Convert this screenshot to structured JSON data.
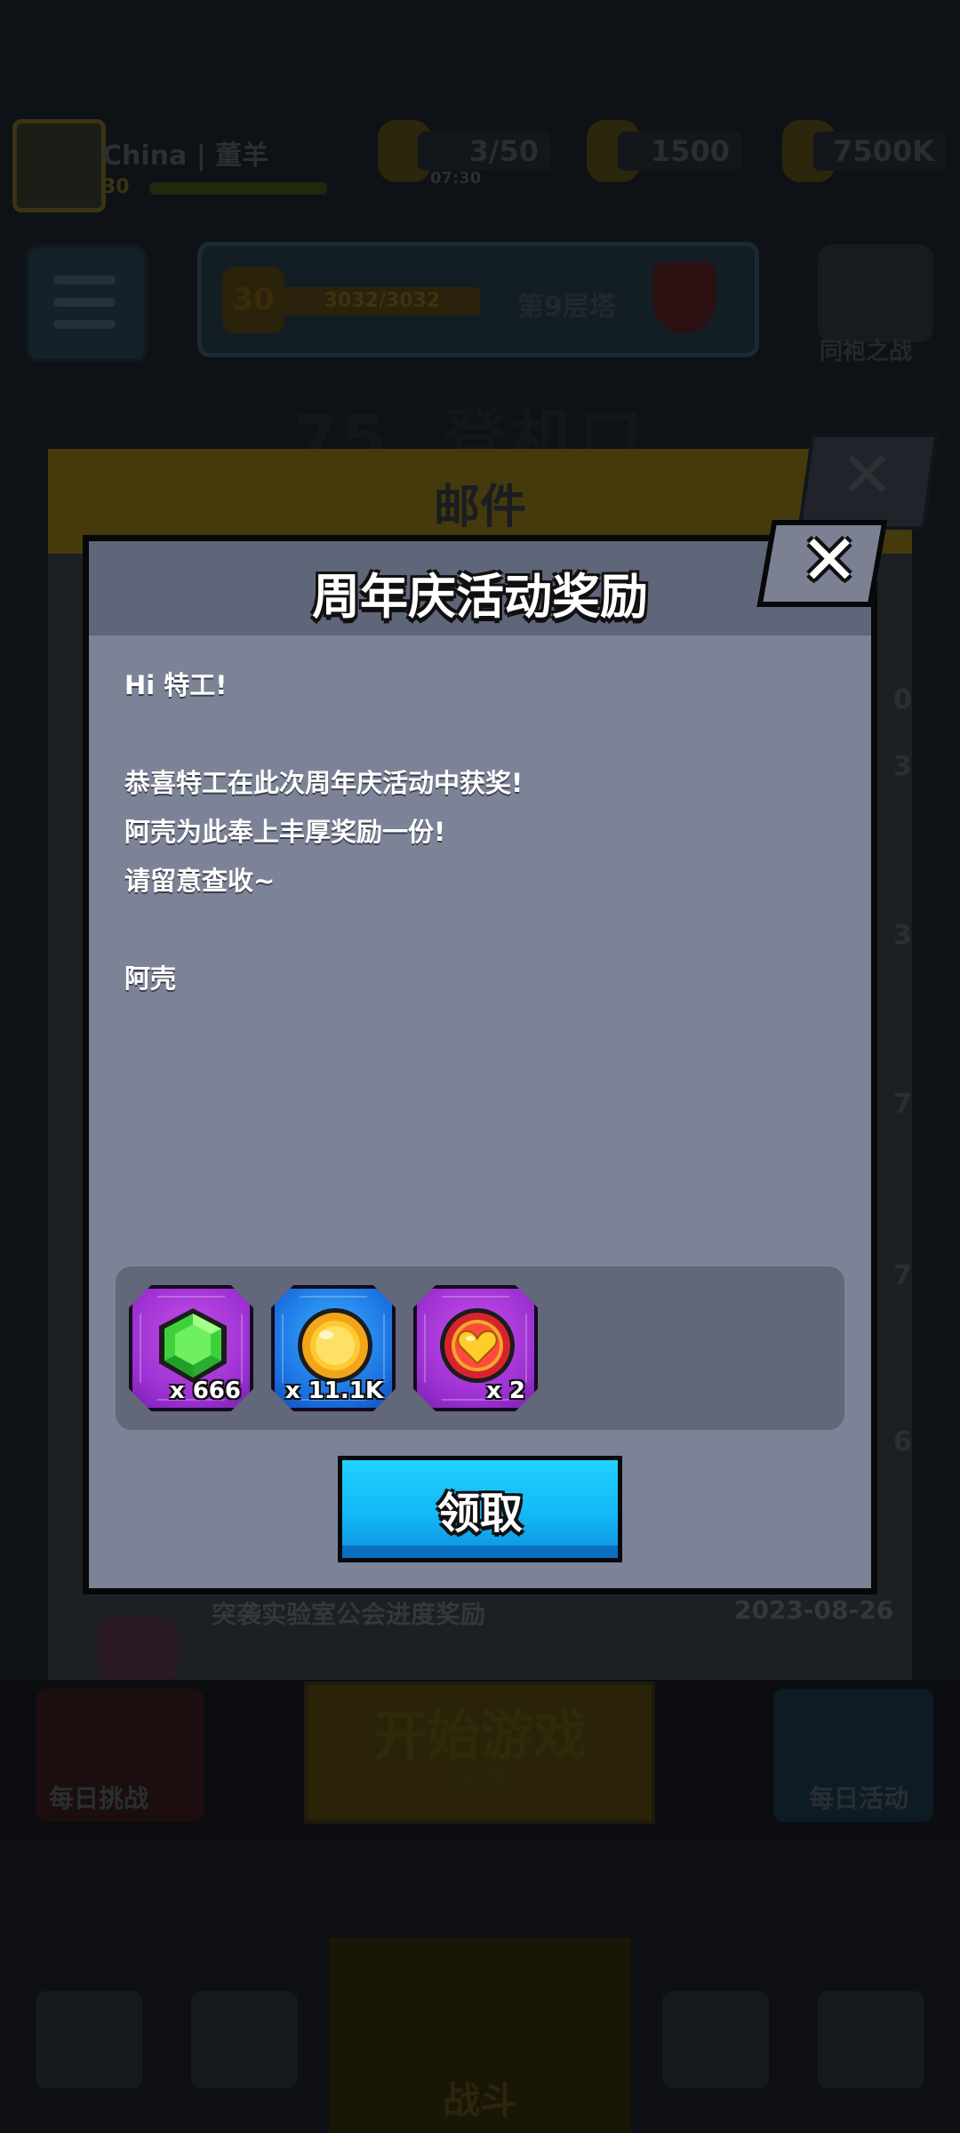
{
  "background": {
    "player": {
      "name": "China | 董羊",
      "level": "30"
    },
    "resources": [
      {
        "name": "energy",
        "value": "3/50",
        "sub": "07:30"
      },
      {
        "name": "gems",
        "value": "1500"
      },
      {
        "name": "coins",
        "value": "7500K"
      }
    ],
    "rank": {
      "badge": "30",
      "bar": "3032/3032",
      "text": "第9层塔"
    },
    "guild_label": "同袍之战",
    "level_title": "75. 登机口",
    "mail_window": {
      "title": "邮件",
      "side_numbers": [
        "0",
        "3",
        "3",
        "7",
        "7",
        "6"
      ],
      "last_item": {
        "title": "突袭实验室公会进度奖励",
        "date": "2023-08-26"
      }
    },
    "bottom": {
      "left_label": "每日挑战",
      "start_label": "开始游戏",
      "start_sub": "× 5",
      "right_label": "每日活动",
      "nav_center_label": "战斗"
    }
  },
  "dialog": {
    "title": "周年庆活动奖励",
    "close_icon": "close-x-icon",
    "message": {
      "greeting": "Hi 特工!",
      "line1": "恭喜特工在此次周年庆活动中获奖!",
      "line2": "阿壳为此奉上丰厚奖励一份!",
      "line3": "请留意查收~",
      "signature": "阿壳"
    },
    "rewards": [
      {
        "icon": "green-gem-icon",
        "quantity": "x 666",
        "frame": "purple"
      },
      {
        "icon": "gold-coin-icon",
        "quantity": "x 11.1K",
        "frame": "blue"
      },
      {
        "icon": "heart-icon",
        "quantity": "x 2",
        "frame": "purple"
      }
    ],
    "claim_label": "领取",
    "colors": {
      "dialog_bg": "#7c8396",
      "header_bg": "#5f6679",
      "claim_button": "#14b8f6",
      "tile_purple": "#9a2fd0",
      "tile_blue": "#1a6fe0"
    }
  }
}
